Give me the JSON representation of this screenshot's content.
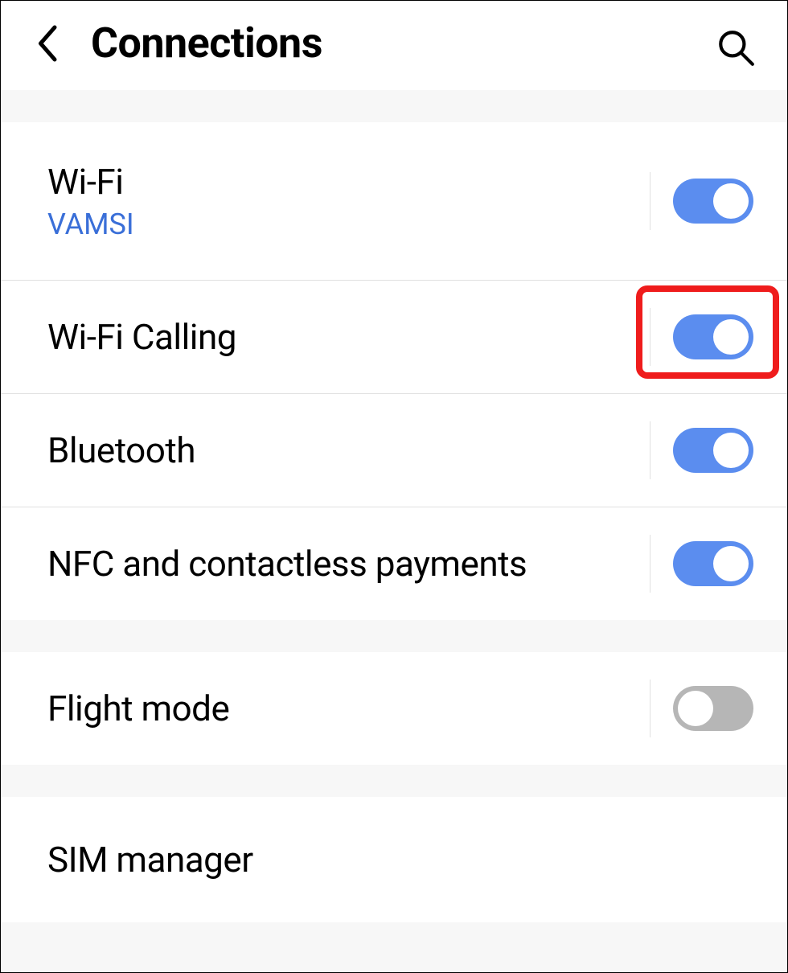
{
  "header": {
    "title": "Connections"
  },
  "sections": [
    {
      "rows": [
        {
          "id": "wifi",
          "label": "Wi-Fi",
          "sublabel": "VAMSI",
          "toggle": true,
          "highlighted": false
        },
        {
          "id": "wifi-calling",
          "label": "Wi-Fi Calling",
          "toggle": true,
          "highlighted": true
        },
        {
          "id": "bluetooth",
          "label": "Bluetooth",
          "toggle": true,
          "highlighted": false
        },
        {
          "id": "nfc",
          "label": "NFC and contactless payments",
          "toggle": true,
          "highlighted": false
        }
      ]
    },
    {
      "rows": [
        {
          "id": "flight-mode",
          "label": "Flight mode",
          "toggle": false,
          "highlighted": false
        }
      ]
    },
    {
      "rows": [
        {
          "id": "sim-manager",
          "label": "SIM manager",
          "toggle": null,
          "highlighted": false
        }
      ]
    }
  ],
  "colors": {
    "toggle_on": "#5b8def",
    "toggle_off": "#b6b6b6",
    "sublabel": "#3a6fd8",
    "highlight": "#ef1c1c"
  }
}
